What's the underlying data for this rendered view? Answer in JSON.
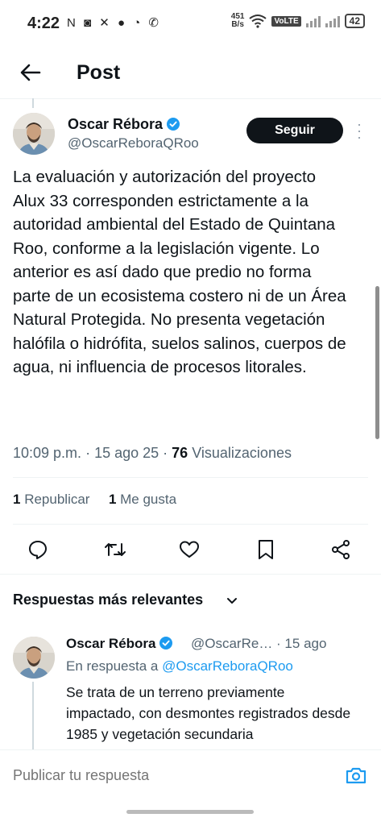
{
  "status_bar": {
    "time": "4:22",
    "left_icons": "N ◙ ✕ ● ◔ ✆",
    "net_speed_value": "451",
    "net_speed_unit": "B/s",
    "volte": "VoLTE",
    "battery": "42"
  },
  "header": {
    "title": "Post"
  },
  "tweet": {
    "author_name": "Oscar Rébora",
    "author_handle": "@OscarReboraQRoo",
    "follow_label": "Seguir",
    "text": "La evaluación y autorización del proyecto Alux 33 corresponden estrictamente a la autoridad ambiental del Estado de Quintana Roo, conforme a la legislación vigente. Lo anterior es así dado que predio no forma parte de un ecosistema costero ni de un Área Natural Protegida. No presenta vegetación halófila o hidrófita, suelos salinos, cuerpos de agua, ni influencia de procesos litorales.",
    "time": "10:09 p.m.",
    "date": "15 ago 25",
    "views_count": "76",
    "views_label": "Visualizaciones",
    "reposts_count": "1",
    "reposts_label": "Republicar",
    "likes_count": "1",
    "likes_label": "Me gusta"
  },
  "replies": {
    "sort_label": "Respuestas más relevantes",
    "items": [
      {
        "author_name": "Oscar Rébora",
        "handle_time": "@OscarRe… · 15 ago",
        "reply_prefix": "En respuesta a",
        "reply_to": "@OscarReboraQRoo",
        "text": "Se trata de un terreno previamente impactado, con desmontes registrados desde 1985 y vegetación secundaria"
      }
    ]
  },
  "composer": {
    "placeholder": "Publicar tu respuesta"
  },
  "colors": {
    "accent": "#1d9bf0",
    "text": "#0f1419",
    "muted": "#536471"
  }
}
